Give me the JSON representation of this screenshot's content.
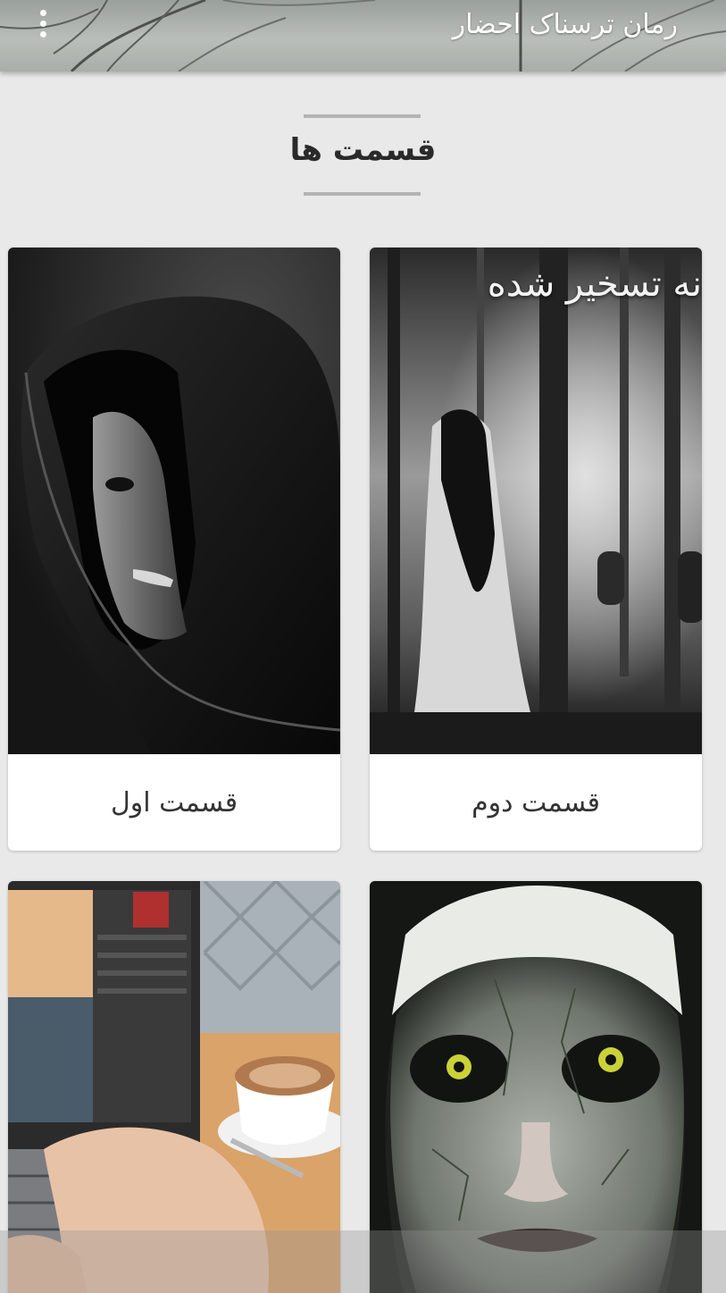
{
  "appbar": {
    "title": "رمان ترسناک احضار",
    "menu_icon": "more-vert-icon"
  },
  "section": {
    "title": "قسمت ها"
  },
  "cards": [
    {
      "label": "قسمت اول",
      "image": "hooded-figure"
    },
    {
      "label": "قسمت دوم",
      "image": "ghost-woman-forest",
      "overlay": "نه تسخیر شده"
    },
    {
      "label": "",
      "image": "laptop-coffee"
    },
    {
      "label": "",
      "image": "nun-face"
    }
  ],
  "colors": {
    "background": "#e9e9e9",
    "card": "#ffffff",
    "title_text": "#2a2a2a",
    "label_text": "#333333"
  }
}
